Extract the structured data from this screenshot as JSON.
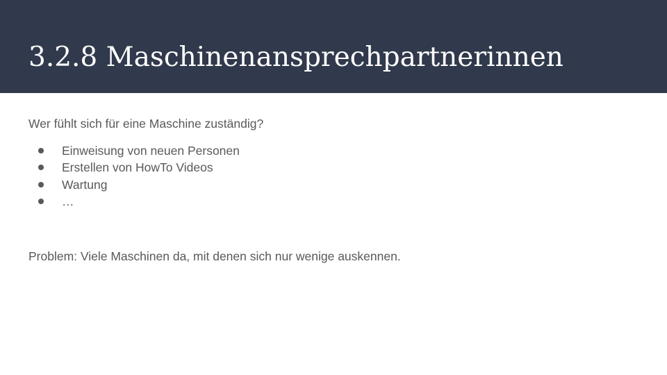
{
  "slide": {
    "title": "3.2.8 Maschinenansprechpartnerinnen",
    "intro": "Wer fühlt sich für eine Maschine zuständig?",
    "bullets": [
      "Einweisung von neuen Personen",
      "Erstellen von HowTo Videos",
      "Wartung",
      "…"
    ],
    "problem": "Problem: Viele Maschinen da, mit denen sich nur wenige auskennen."
  },
  "colors": {
    "title_bar": "#313a4c",
    "title_text": "#ffffff",
    "body_text": "#595959"
  }
}
